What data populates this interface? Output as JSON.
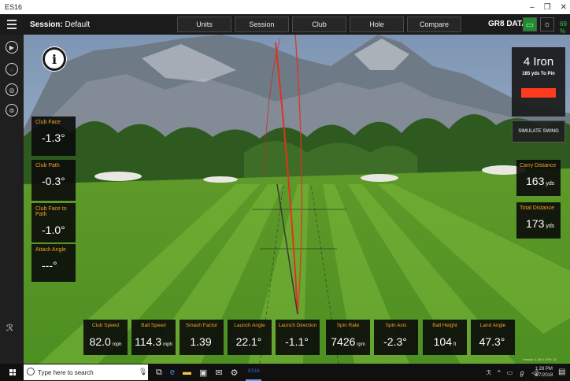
{
  "window": {
    "title": "ES16",
    "minimize": "–",
    "restore": "❐",
    "close": "✕"
  },
  "topbar": {
    "session_label": "Session:",
    "session_name": "Default",
    "menu": [
      "Units",
      "Session",
      "Club",
      "Hole",
      "Compare"
    ],
    "brand": "GR8 DATA",
    "battery_pct": "69 %"
  },
  "club": {
    "name": "4 Iron",
    "subtitle": "185 yds To Pin",
    "indicator_color": "#ff3b1f",
    "simulate_label": "SIMULATE SWING"
  },
  "left_metrics": [
    {
      "label": "Club Face",
      "value": "-1.3°"
    },
    {
      "label": "Club Path",
      "value": "-0.3°"
    },
    {
      "label": "Club Face to Path",
      "value": "-1.0°"
    },
    {
      "label": "Attack Angle",
      "value": "---°"
    }
  ],
  "right_metrics": [
    {
      "label": "Carry Distance",
      "value": "163",
      "unit": "yds"
    },
    {
      "label": "Total Distance",
      "value": "173",
      "unit": "yds"
    }
  ],
  "bottom_metrics": [
    {
      "label": "Club Speed",
      "value": "82.0",
      "unit": "mph"
    },
    {
      "label": "Ball Speed",
      "value": "114.3",
      "unit": "mph"
    },
    {
      "label": "Smash Factor",
      "value": "1.39",
      "unit": ""
    },
    {
      "label": "Launch Angle",
      "value": "22.1°",
      "unit": ""
    },
    {
      "label": "Launch Direction",
      "value": "-1.1°",
      "unit": ""
    },
    {
      "label": "Spin Rate",
      "value": "7426",
      "unit": "rpm"
    },
    {
      "label": "Spin Axis",
      "value": "-2.3°",
      "unit": ""
    },
    {
      "label": "Ball Height",
      "value": "104",
      "unit": "ft"
    },
    {
      "label": "Land Angle",
      "value": "47.3°",
      "unit": ""
    }
  ],
  "version": "Version: 1.35.0 | FW: 15",
  "taskbar": {
    "search_placeholder": "Type here to search",
    "app_label": "ES16",
    "time": "1:28 PM",
    "date": "8/7/2018"
  },
  "colors": {
    "accent_label": "#f0a31f",
    "trajectory": "#e0321f",
    "status_green": "#35c44a"
  },
  "icons": [
    "hamburger-icon",
    "play-icon",
    "golf-ball-icon",
    "target-icon",
    "settings-icon",
    "person-icon",
    "search-icon",
    "mic-icon",
    "windows-icon"
  ]
}
